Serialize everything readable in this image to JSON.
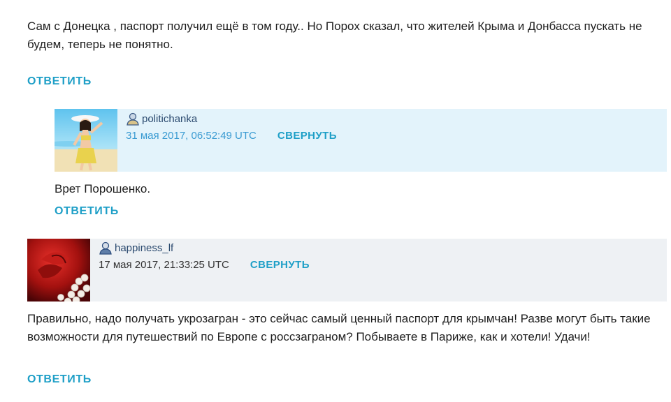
{
  "comment_top": {
    "text": "Сам с Донецка , паспорт получил ещё в том году.. Но Порох сказал, что жителей Крыма и Донбасса пускать не будем, теперь не понятно.",
    "reply_label": "ОТВЕТИТЬ"
  },
  "comment_politichanka": {
    "username": "politichanka",
    "timestamp": "31 мая 2017, 06:52:49 UTC",
    "collapse_label": "СВЕРНУТЬ",
    "text": "Врет Порошенко.",
    "reply_label": "ОТВЕТИТЬ",
    "avatar_icon": "avatar-beach-woman",
    "user_icon": "user-profile-icon"
  },
  "comment_happiness": {
    "username": "happiness_lf",
    "timestamp": "17 мая 2017, 21:33:25 UTC",
    "collapse_label": "СВЕРНУТЬ",
    "text": "Правильно, надо получать укрозагран - это сейчас самый ценный паспорт для крымчан! Разве могут быть такие возможности для путешествий по Европе с россзаграном? Побываете в Париже, как и хотели! Удачи!",
    "reply_label": "ОТВЕТИТЬ",
    "avatar_icon": "avatar-rose-pearls",
    "user_icon": "user-profile-icon"
  },
  "colors": {
    "accent": "#1e9fc7",
    "header_blue": "#e3f3fb",
    "header_gray": "#eef1f4",
    "timestamp_blue": "#3a9bd2"
  }
}
